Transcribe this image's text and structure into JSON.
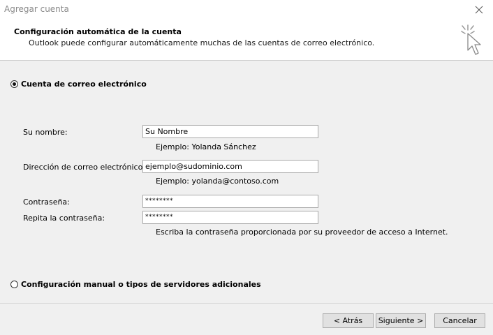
{
  "window": {
    "title": "Agregar cuenta"
  },
  "header": {
    "title": "Configuración automática de la cuenta",
    "subtitle": "Outlook puede configurar automáticamente muchas de las cuentas de correo electrónico."
  },
  "options": {
    "email_account": "Cuenta de correo electrónico",
    "manual": "Configuración manual o tipos de servidores adicionales"
  },
  "form": {
    "name_label": "Su nombre:",
    "name_value": "Su Nombre",
    "name_hint": "Ejemplo: Yolanda Sánchez",
    "email_label": "Dirección de correo electrónico:",
    "email_value": "ejemplo@sudominio.com",
    "email_hint": "Ejemplo: yolanda@contoso.com",
    "password_label": "Contraseña:",
    "password_value": "********",
    "repeat_label": "Repita la contraseña:",
    "repeat_value": "********",
    "password_hint": "Escriba la contraseña proporcionada por su proveedor de acceso a Internet."
  },
  "buttons": {
    "back": "< Atrás",
    "next": "Siguiente >",
    "cancel": "Cancelar"
  }
}
